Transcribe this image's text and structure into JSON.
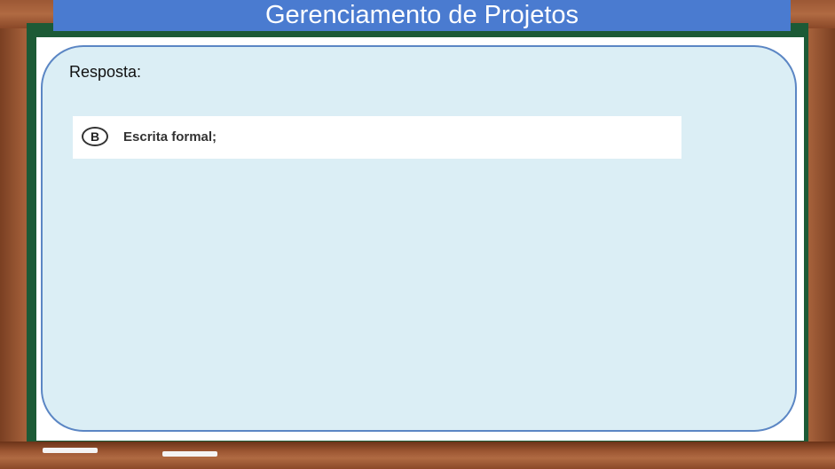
{
  "slide": {
    "title": "Gerenciamento de Projetos",
    "answer_label": "Resposta:",
    "option": {
      "letter": "B",
      "text": "Escrita formal;"
    }
  },
  "colors": {
    "title_bar": "#4a7bd0",
    "card_background": "#dbeef5",
    "card_border": "#5b86c4",
    "board_green": "#1c5a36",
    "frame_wood": "#8b4a2a"
  }
}
